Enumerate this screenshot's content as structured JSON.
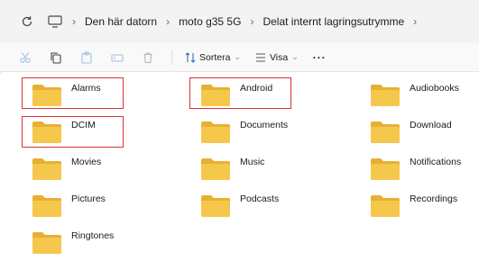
{
  "address": {
    "crumbs": [
      "Den här datorn",
      "moto g35 5G",
      "Delat internt lagringsutrymme"
    ]
  },
  "toolbar": {
    "sort_label": "Sortera",
    "view_label": "Visa",
    "more_label": "···"
  },
  "folders": [
    {
      "name": "Alarms"
    },
    {
      "name": "Android"
    },
    {
      "name": "Audiobooks"
    },
    {
      "name": "DCIM"
    },
    {
      "name": "Documents"
    },
    {
      "name": "Download"
    },
    {
      "name": "Movies"
    },
    {
      "name": "Music"
    },
    {
      "name": "Notifications"
    },
    {
      "name": "Pictures"
    },
    {
      "name": "Podcasts"
    },
    {
      "name": "Recordings"
    },
    {
      "name": "Ringtones"
    }
  ],
  "highlighted": [
    "Alarms",
    "Android",
    "DCIM"
  ],
  "colors": {
    "folder_front": "#f5c84c",
    "folder_back": "#e8b030",
    "highlight": "#d6353a"
  }
}
